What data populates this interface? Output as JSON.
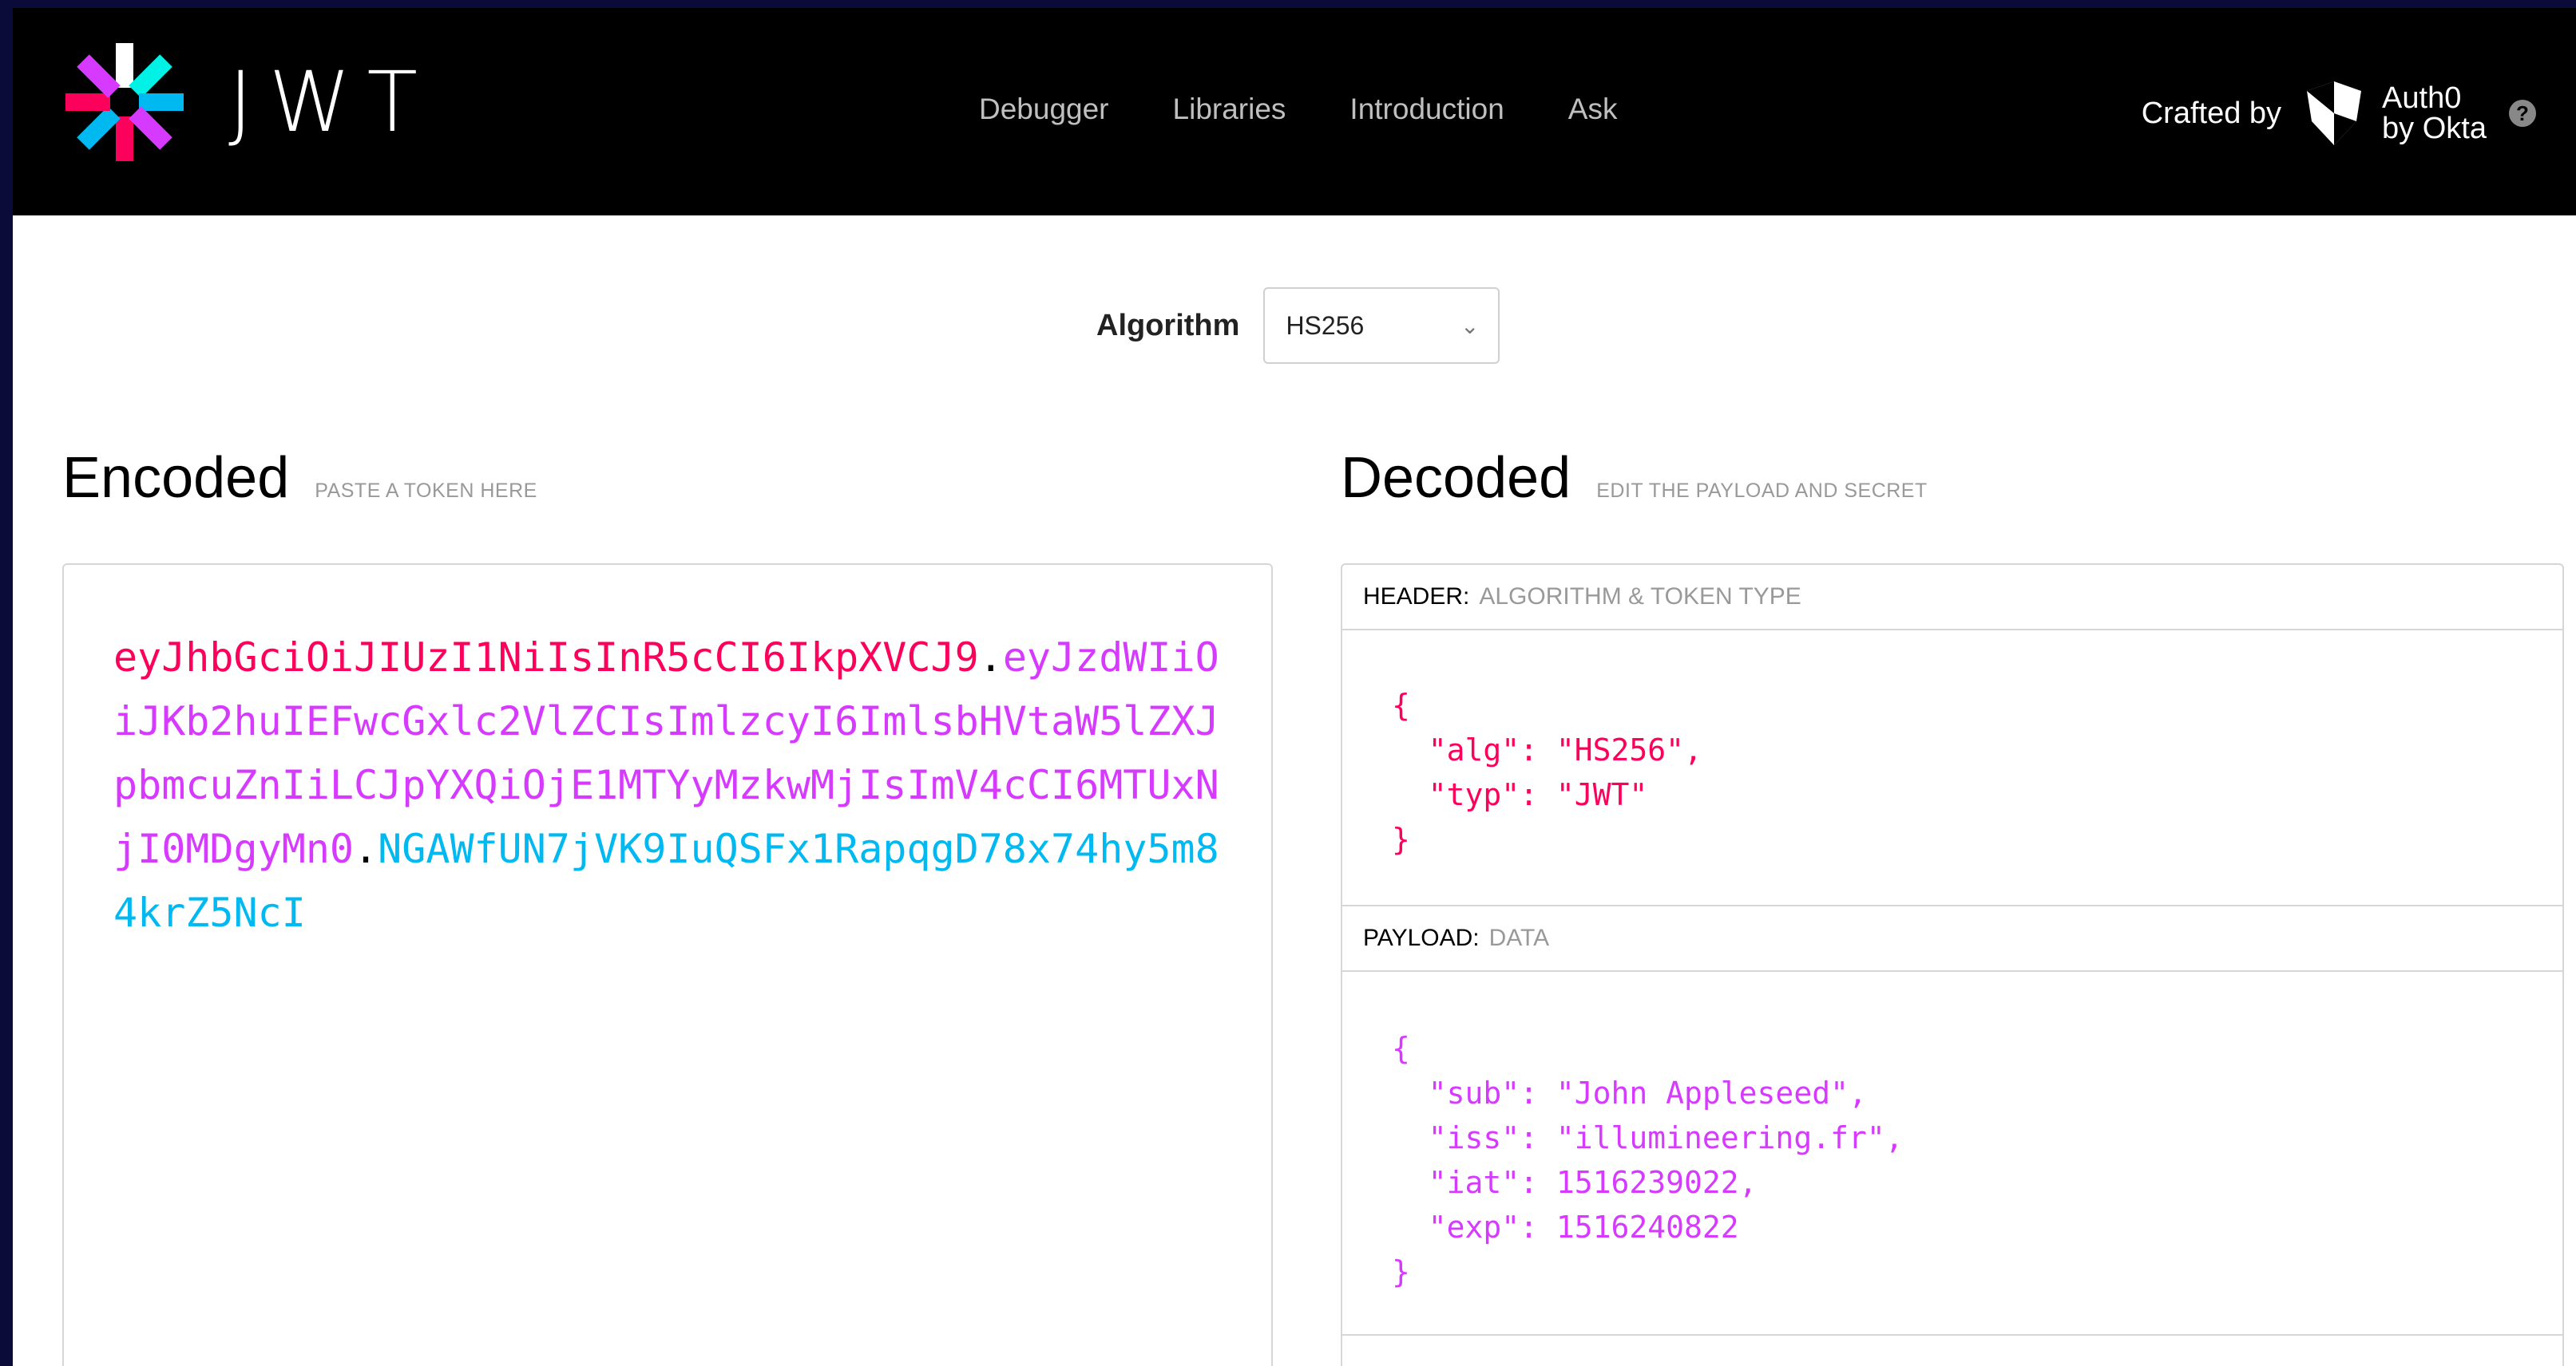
{
  "brand": {
    "wordmark": "JWT"
  },
  "nav": [
    "Debugger",
    "Libraries",
    "Introduction",
    "Ask"
  ],
  "crafted": {
    "text": "Crafted by",
    "brand_line1": "Auth0",
    "brand_line2": "by Okta",
    "help": "?"
  },
  "algorithm": {
    "label": "Algorithm",
    "value": "HS256"
  },
  "encoded": {
    "title": "Encoded",
    "subtitle": "PASTE A TOKEN HERE",
    "token_header": "eyJhbGciOiJIUzI1NiIsInR5cCI6IkpXVCJ9",
    "token_payload": "eyJzdWIiOiJKb2huIEFwcGxlc2VlZCIsImlzcyI6ImlsbHVtaW5lZXJpbmcuZnIiLCJpYXQiOjE1MTYyMzkwMjIsImV4cCI6MTUxNjI0MDgyMn0",
    "token_signature": "NGAWfUN7jVK9IuQSFx1RapqgD78x74hy5m84krZ5NcI",
    "dot": "."
  },
  "decoded": {
    "title": "Decoded",
    "subtitle": "EDIT THE PAYLOAD AND SECRET",
    "header_label": "HEADER:",
    "header_desc": "ALGORITHM & TOKEN TYPE",
    "header_json": "{\n  \"alg\": \"HS256\",\n  \"typ\": \"JWT\"\n}",
    "payload_label": "PAYLOAD:",
    "payload_desc": "DATA",
    "payload_json": "{\n  \"sub\": \"John Appleseed\",\n  \"iss\": \"illumineering.fr\",\n  \"iat\": 1516239022,\n  \"exp\": 1516240822\n}"
  },
  "colors": {
    "header": "#fb015b",
    "payload": "#d63aff",
    "signature": "#00b9f1",
    "page_border": "#0b0b3a"
  },
  "icons": {
    "logo": "jwt-asterisk-logo-icon",
    "auth0": "auth0-shield-icon",
    "help": "help-circle-icon",
    "select_chevron": "chevron-down-icon"
  }
}
